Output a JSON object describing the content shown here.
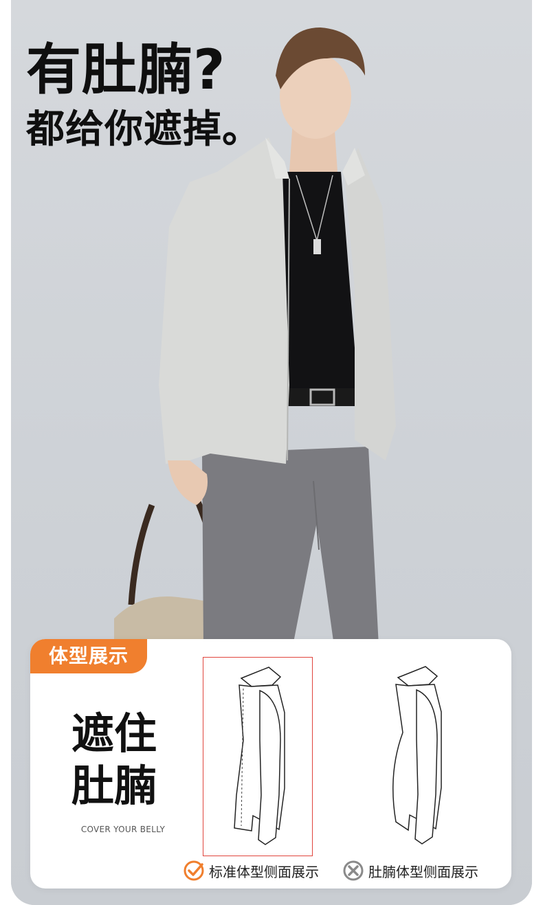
{
  "headline": {
    "line1": "有肚腩?",
    "line2": "都给你遮掉。"
  },
  "card": {
    "tag": "体型展示",
    "big_line1": "遮住",
    "big_line2": "肚腩",
    "subtitle": "COVER YOUR BELLY",
    "legend_standard": "标准体型侧面展示",
    "legend_belly": "肚腩体型侧面展示"
  },
  "colors": {
    "accent": "#f07f2e",
    "frame_red": "#e0443c"
  }
}
